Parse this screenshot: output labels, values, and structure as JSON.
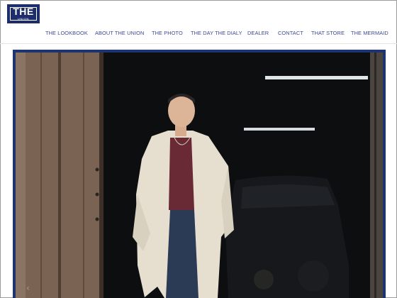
{
  "brand": {
    "logo_main": "THE",
    "logo_sub": "UNION",
    "color": "#1d2c6b"
  },
  "nav": {
    "items": [
      {
        "label": "THE LOOKBOOK"
      },
      {
        "label": "ABOUT THE UNION"
      },
      {
        "label": "THE PHOTO"
      },
      {
        "label": "THE DAY THE DIALY"
      },
      {
        "label": "DEALER"
      },
      {
        "label": "CONTACT"
      },
      {
        "label": "THAT STORE"
      },
      {
        "label": "THE MERMAID"
      }
    ],
    "link_color": "#3b4a8f"
  },
  "slider": {
    "prev_icon": "chevron-left-icon",
    "frame_color": "#1d3470"
  }
}
